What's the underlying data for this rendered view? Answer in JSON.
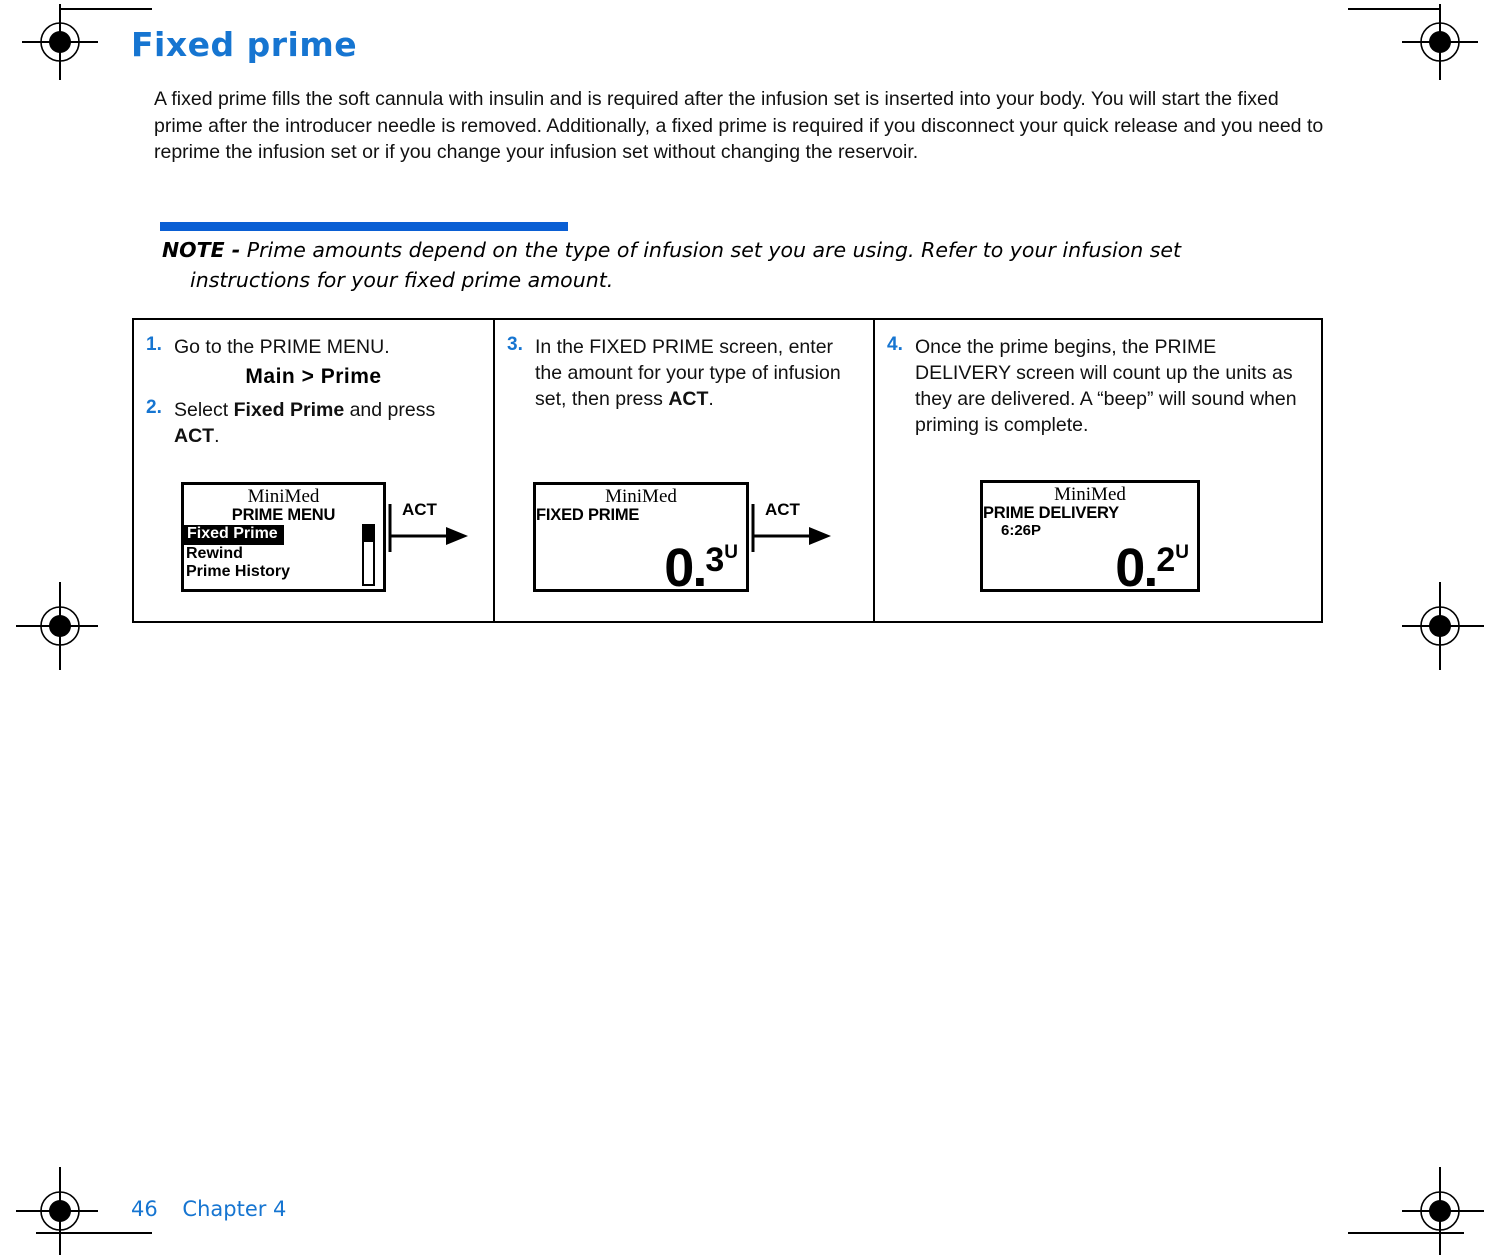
{
  "page": {
    "heading": "Fixed prime",
    "intro_paragraph": "A fixed prime fills the soft cannula with insulin and is required after the infusion set is inserted into your body. You will start the fixed prime after the introducer needle is removed. Additionally, a fixed prime is required if you disconnect your quick release and you need to reprime the infusion set or if you change your infusion set without changing the reservoir.",
    "accent_color": "#1675d1",
    "note_bar_color": "#0a5fd4"
  },
  "note": {
    "label": "NOTE -",
    "line1": "Prime amounts depend on the type of infusion set you are using. Refer to your infusion set",
    "line2": "instructions for your fixed prime amount."
  },
  "steps": {
    "col1": {
      "step1_num": "1.",
      "step1_text": "Go to the PRIME MENU.",
      "menu_path": "Main > Prime",
      "step2_num": "2.",
      "step2_text_a": "Select ",
      "step2_bold_a": "Fixed Prime",
      "step2_text_b": " and press ",
      "step2_bold_b": "ACT",
      "step2_text_c": ".",
      "act_label": "ACT"
    },
    "col2": {
      "step3_num": "3.",
      "step3_text_a": "In the FIXED PRIME screen, enter the amount for your type of infusion set, then press ",
      "step3_bold": "ACT",
      "step3_text_b": ".",
      "act_label": "ACT"
    },
    "col3": {
      "step4_num": "4.",
      "step4_text": "Once the prime begins, the PRIME DELIVERY screen will count up the units as they are delivered. A “beep” will sound when priming is complete."
    }
  },
  "pump_screens": {
    "prime_menu": {
      "logo": "MiniMed",
      "title": "PRIME MENU",
      "items": [
        {
          "label": "Fixed Prime",
          "selected": true
        },
        {
          "label": "Rewind",
          "selected": false
        },
        {
          "label": "Prime History",
          "selected": false
        }
      ]
    },
    "fixed_prime": {
      "logo": "MiniMed",
      "title": "FIXED PRIME",
      "value_whole": "0.",
      "value_decimal": "3",
      "value_unit": "U"
    },
    "prime_delivery": {
      "logo": "MiniMed",
      "title": "PRIME DELIVERY",
      "time": "6:26P",
      "value_whole": "0.",
      "value_decimal": "2",
      "value_unit": "U"
    }
  },
  "footer": {
    "page_number": "46",
    "chapter": "Chapter 4"
  }
}
